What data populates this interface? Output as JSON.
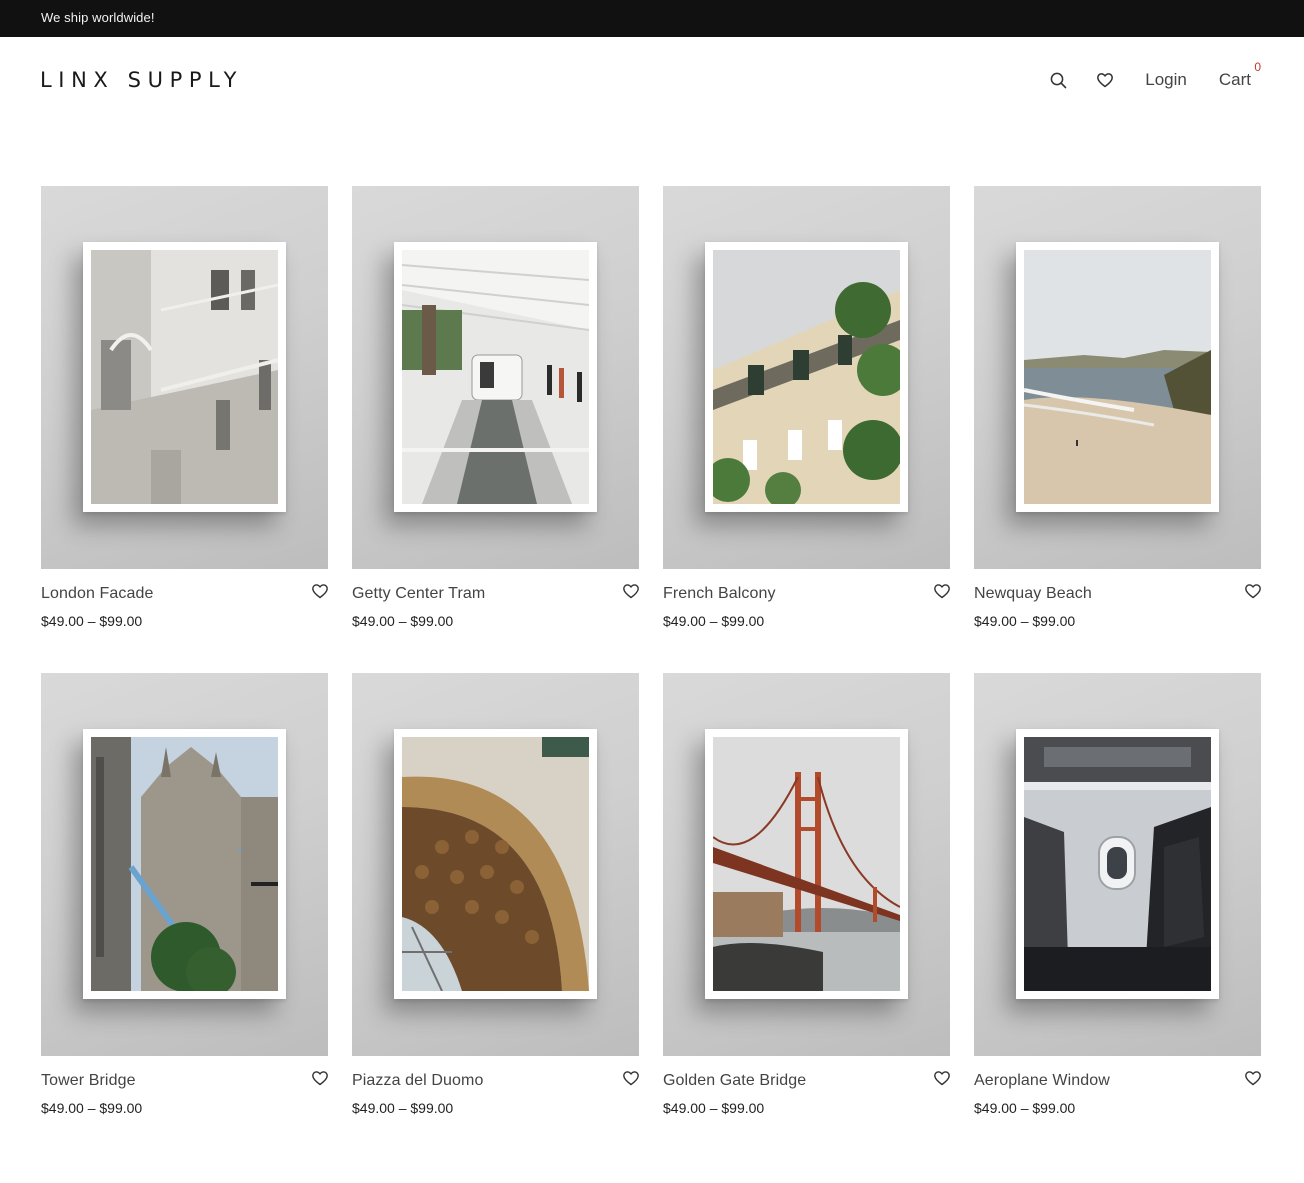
{
  "announcement": "We ship worldwide!",
  "header": {
    "logo": "LINX SUPPLY",
    "search_icon": "search-icon",
    "wishlist_icon": "heart-icon",
    "login_label": "Login",
    "cart_label": "Cart",
    "cart_count": "0"
  },
  "colors": {
    "topbar": "#111111",
    "cart_badge": "#c0392b",
    "background": "#ffffff"
  },
  "products": [
    {
      "title": "London Facade",
      "price": "$49.00 – $99.00"
    },
    {
      "title": "Getty Center Tram",
      "price": "$49.00 – $99.00"
    },
    {
      "title": "French Balcony",
      "price": "$49.00 – $99.00"
    },
    {
      "title": "Newquay Beach",
      "price": "$49.00 – $99.00"
    },
    {
      "title": "Tower Bridge",
      "price": "$49.00 – $99.00"
    },
    {
      "title": "Piazza del Duomo",
      "price": "$49.00 – $99.00"
    },
    {
      "title": "Golden Gate Bridge",
      "price": "$49.00 – $99.00"
    },
    {
      "title": "Aeroplane Window",
      "price": "$49.00 – $99.00"
    }
  ]
}
